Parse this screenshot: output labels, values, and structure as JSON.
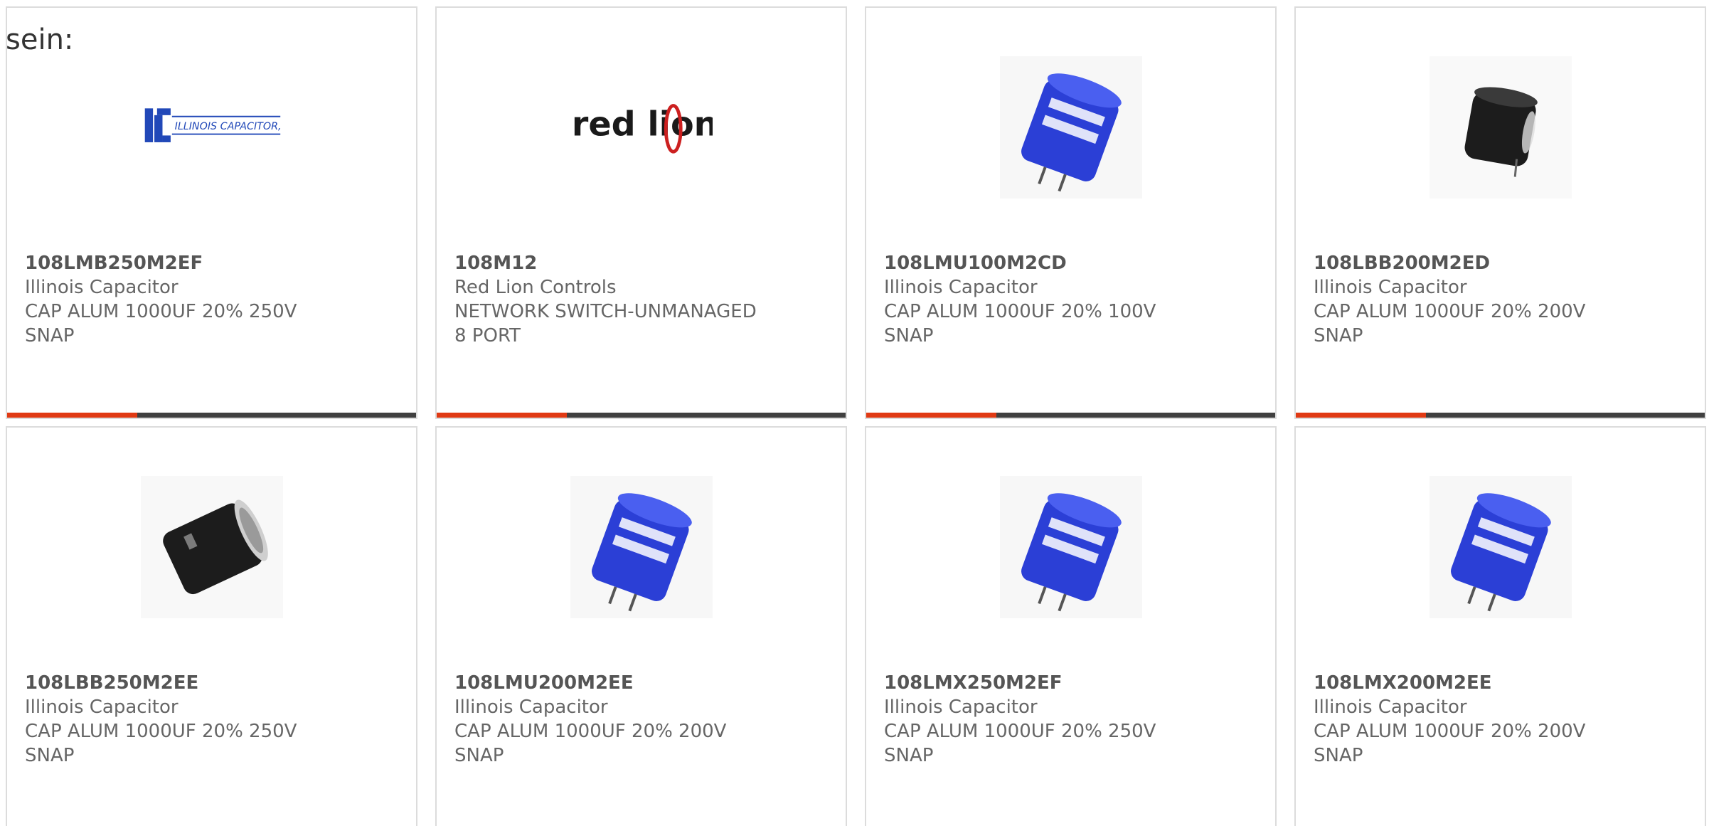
{
  "header": {
    "label": "sein:"
  },
  "colors": {
    "accent": "#e03a14",
    "bar": "#404040",
    "border": "#dcdcdc",
    "text": "#666666",
    "capacitor_blue": "#2b3fd6",
    "capacitor_black": "#1c1c1c"
  },
  "products": [
    {
      "part_number": "108LMB250M2EF",
      "manufacturer": "Illinois Capacitor",
      "description": "CAP ALUM 1000UF 20% 250V\nSNAP",
      "image": "illinois-capacitor-logo"
    },
    {
      "part_number": "108M12",
      "manufacturer": "Red Lion Controls",
      "description": "NETWORK SWITCH-UNMANAGED\n8 PORT",
      "image": "red-lion-logo",
      "logo_text": "red lion"
    },
    {
      "part_number": "108LMU100M2CD",
      "manufacturer": "Illinois Capacitor",
      "description": "CAP ALUM 1000UF 20% 100V\nSNAP",
      "image": "blue-capacitor"
    },
    {
      "part_number": "108LBB200M2ED",
      "manufacturer": "Illinois Capacitor",
      "description": "CAP ALUM 1000UF 20% 200V\nSNAP",
      "image": "black-capacitor-small"
    },
    {
      "part_number": "108LBB250M2EE",
      "manufacturer": "Illinois Capacitor",
      "description": "CAP ALUM 1000UF 20% 250V\nSNAP",
      "image": "black-capacitor"
    },
    {
      "part_number": "108LMU200M2EE",
      "manufacturer": "Illinois Capacitor",
      "description": "CAP ALUM 1000UF 20% 200V\nSNAP",
      "image": "blue-capacitor"
    },
    {
      "part_number": "108LMX250M2EF",
      "manufacturer": "Illinois Capacitor",
      "description": "CAP ALUM 1000UF 20% 250V\nSNAP",
      "image": "blue-capacitor"
    },
    {
      "part_number": "108LMX200M2EE",
      "manufacturer": "Illinois Capacitor",
      "description": "CAP ALUM 1000UF 20% 200V\nSNAP",
      "image": "blue-capacitor"
    }
  ]
}
